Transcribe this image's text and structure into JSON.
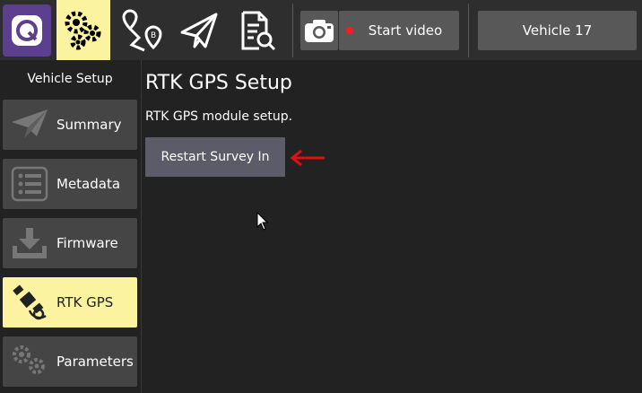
{
  "toolbar": {
    "icons": [
      "qgc-logo-icon",
      "settings-gears-icon",
      "plan-route-icon",
      "fly-paper-plane-icon",
      "analyze-icon",
      "camera-icon"
    ],
    "start_video_label": "Start video",
    "vehicle_label": "Vehicle 17",
    "colors": {
      "active": "#fbf3a0",
      "logo_bg": "#5c3f8f",
      "record_dot": "#ff1a1a"
    }
  },
  "sidebar": {
    "title": "Vehicle Setup",
    "items": [
      {
        "label": "Summary",
        "icon": "paper-plane-icon"
      },
      {
        "label": "Metadata",
        "icon": "list-icon"
      },
      {
        "label": "Firmware",
        "icon": "download-icon"
      },
      {
        "label": "RTK GPS",
        "icon": "satellite-icon",
        "active": true
      },
      {
        "label": "Parameters",
        "icon": "gears-icon"
      }
    ]
  },
  "main": {
    "title": "RTK GPS Setup",
    "description": "RTK GPS module setup.",
    "restart_button": "Restart Survey In"
  }
}
